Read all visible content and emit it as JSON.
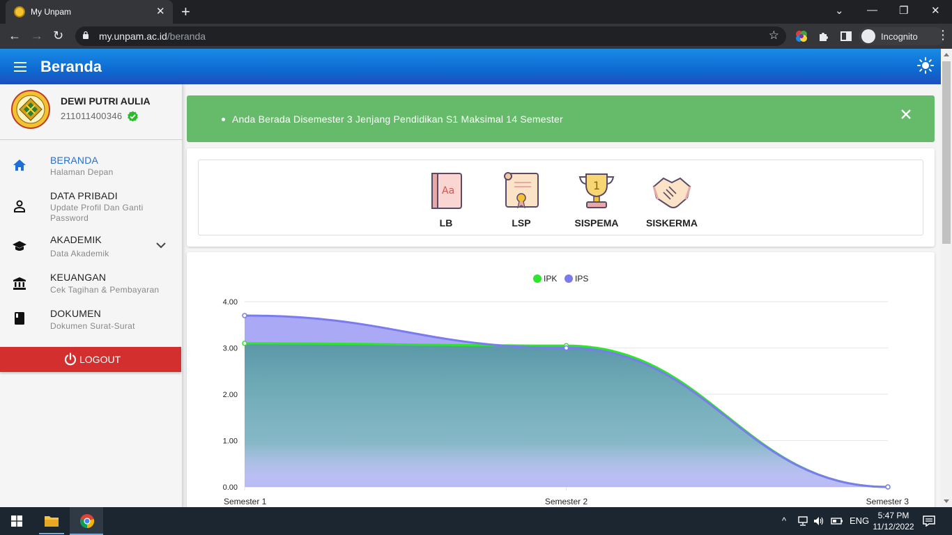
{
  "browser": {
    "tab_title": "My Unpam",
    "url_host": "my.unpam.ac.id",
    "url_path": "/beranda",
    "profile_label": "Incognito"
  },
  "header": {
    "title": "Beranda"
  },
  "user": {
    "name": "DEWI PUTRI AULIA",
    "nim": "211011400346"
  },
  "sidebar": {
    "items": [
      {
        "label": "BERANDA",
        "sub": "Halaman Depan",
        "icon": "home-icon"
      },
      {
        "label": "DATA PRIBADI",
        "sub": "Update Profil Dan Ganti Password",
        "icon": "person-icon"
      },
      {
        "label": "AKADEMIK",
        "sub": "Data Akademik",
        "icon": "graduation-cap-icon"
      },
      {
        "label": "KEUANGAN",
        "sub": "Cek Tagihan & Pembayaran",
        "icon": "bank-icon"
      },
      {
        "label": "DOKUMEN",
        "sub": "Dokumen Surat-Surat",
        "icon": "book-icon"
      }
    ],
    "logout_label": "LOGOUT"
  },
  "alert": {
    "message": "Anda Berada Disemester 3 Jenjang Pendidikan S1 Maksimal 14 Semester"
  },
  "shortcuts": [
    {
      "label": "LB",
      "icon": "dictionary-book-icon"
    },
    {
      "label": "LSP",
      "icon": "certificate-scroll-icon"
    },
    {
      "label": "SISPEMA",
      "icon": "trophy-icon"
    },
    {
      "label": "SISKERMA",
      "icon": "handshake-icon"
    }
  ],
  "chart_data": {
    "type": "area",
    "categories": [
      "Semester 1",
      "Semester 2",
      "Semester 3"
    ],
    "series": [
      {
        "name": "IPK",
        "values": [
          3.1,
          3.05,
          0.0
        ],
        "color": "#2ee52e"
      },
      {
        "name": "IPS",
        "values": [
          3.7,
          3.0,
          0.0
        ],
        "color": "#7b7bf0"
      }
    ],
    "yticks": [
      "4.00",
      "3.00",
      "2.00",
      "1.00",
      "0.00"
    ],
    "ylim": [
      0,
      4
    ],
    "legend": "top-center",
    "grid": true
  },
  "taskbar": {
    "language": "ENG",
    "time": "5:47 PM",
    "date": "11/12/2022"
  },
  "colors": {
    "header_blue": "#1a8be6",
    "alert_green": "#66bb6a",
    "logout_red": "#d32f2f",
    "active_nav": "#1e6fd6"
  }
}
